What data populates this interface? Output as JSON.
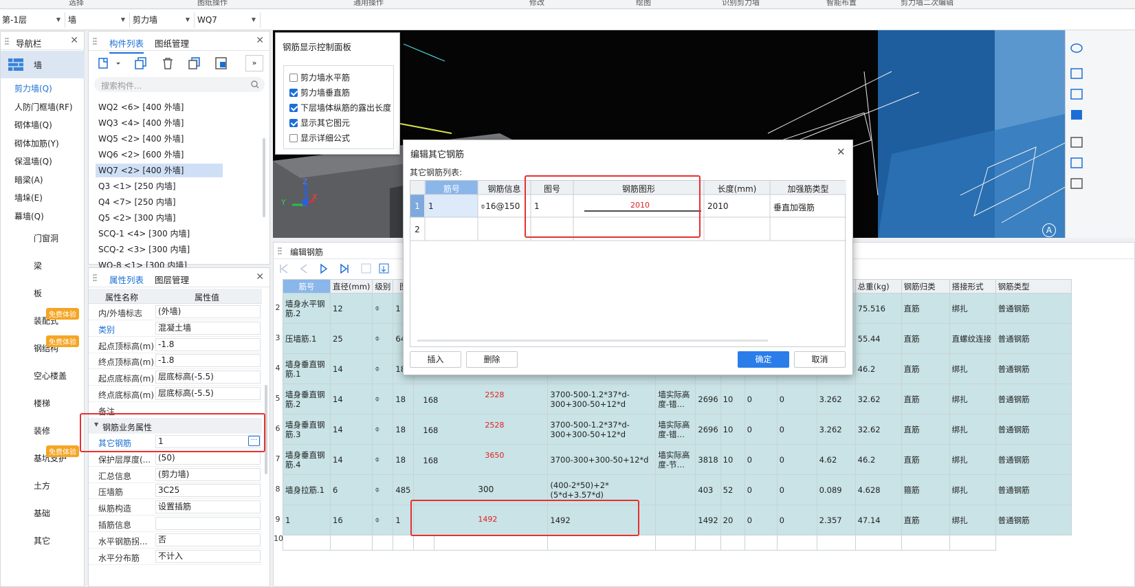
{
  "ribbon": [
    "选择",
    "图纸操作",
    "通用操作",
    "修改",
    "绘图",
    "识别剪力墙",
    "智能布置",
    "剪力墙二次编辑"
  ],
  "selectors": [
    "第-1层",
    "墙",
    "剪力墙",
    "WQ7"
  ],
  "nav": {
    "title": "导航栏",
    "top_category": "墙",
    "items": [
      "剪力墙(Q)",
      "人防门框墙(RF)",
      "砌体墙(Q)",
      "砌体加筋(Y)",
      "保温墙(Q)",
      "暗梁(A)",
      "墙垛(E)",
      "幕墙(Q)"
    ],
    "categories": [
      "门窗洞",
      "梁",
      "板",
      "装配式",
      "钢结构",
      "空心楼盖",
      "楼梯",
      "装修",
      "基坑支护",
      "土方",
      "基础",
      "其它"
    ],
    "badge": "免费体验"
  },
  "components": {
    "tabs": [
      "构件列表",
      "图纸管理"
    ],
    "search_placeholder": "搜索构件...",
    "items": [
      "WQ2 <6> [400 外墙]",
      "WQ3 <4> [400 外墙]",
      "WQ5 <2> [400 外墙]",
      "WQ6 <2> [600 外墙]",
      "WQ7 <2> [400 外墙]",
      "Q3 <1> [250 内墙]",
      "Q4 <7> [250 内墙]",
      "Q5 <2> [300 内墙]",
      "SCQ-1 <4> [300 内墙]",
      "SCQ-2 <3> [300 内墙]",
      "WQ-8 <1> [300 内墙]"
    ]
  },
  "props": {
    "tabs": [
      "属性列表",
      "图层管理"
    ],
    "header": [
      "属性名称",
      "属性值"
    ],
    "rows": [
      [
        "内/外墙标志",
        "(外墙)"
      ],
      [
        "类别",
        "混凝土墙"
      ],
      [
        "起点顶标高(m)",
        "-1.8"
      ],
      [
        "终点顶标高(m)",
        "-1.8"
      ],
      [
        "起点底标高(m)",
        "层底标高(-5.5)"
      ],
      [
        "终点底标高(m)",
        "层底标高(-5.5)"
      ],
      [
        "备注",
        ""
      ]
    ],
    "group": "钢筋业务属性",
    "rows2": [
      [
        "其它钢筋",
        "1"
      ],
      [
        "保护层厚度(...",
        "(50)"
      ],
      [
        "汇总信息",
        "(剪力墙)"
      ],
      [
        "压墙筋",
        "3C25"
      ],
      [
        "纵筋构造",
        "设置插筋"
      ],
      [
        "插筋信息",
        ""
      ],
      [
        "水平钢筋拐...",
        "否"
      ],
      [
        "水平分布筋",
        "不计入"
      ]
    ],
    "ellipsis": "···"
  },
  "view3d": {
    "axis_x": "X",
    "axis_y": "Y",
    "axis_z": "Z",
    "corner": "A"
  },
  "display_panel": {
    "title": "钢筋显示控制面板",
    "options": [
      {
        "label": "剪力墙水平筋",
        "checked": false
      },
      {
        "label": "剪力墙垂直筋",
        "checked": true
      },
      {
        "label": "下层墙体纵筋的露出长度",
        "checked": true
      },
      {
        "label": "显示其它图元",
        "checked": true
      },
      {
        "label": "显示详细公式",
        "checked": false
      }
    ]
  },
  "edit_rebar": {
    "title": "编辑钢筋",
    "headers": [
      "筋号",
      "直径(mm)",
      "级别",
      "图",
      "",
      "",
      "",
      "",
      "",
      "",
      "",
      "",
      "g)",
      "总重(kg)",
      "钢筋归类",
      "搭接形式",
      "钢筋类型"
    ],
    "rows": [
      {
        "n": "2",
        "name": "墙身水平钢筋.2",
        "dia": "12",
        "grade": "⌽",
        "fig": "1",
        "bars": "",
        "shape": "",
        "formula": "",
        "desc": "",
        "len": "",
        "cnt": "",
        "a": "",
        "b": "",
        "w1": "",
        "total": "75.516",
        "cat": "直筋",
        "lap": "绑扎",
        "type": "普通钢筋"
      },
      {
        "n": "3",
        "name": "压墙筋.1",
        "dia": "25",
        "grade": "⌽",
        "fig": "64",
        "bars": "",
        "shape": "",
        "formula": "",
        "desc": "",
        "len": "",
        "cnt": "",
        "a": "",
        "b": "",
        "w1": "",
        "total": "55.44",
        "cat": "直筋",
        "lap": "直螺纹连接",
        "type": "普通钢筋"
      },
      {
        "n": "4",
        "name": "墙身垂直钢筋.1",
        "dia": "14",
        "grade": "⌽",
        "fig": "18",
        "bars": "",
        "shape": "",
        "formula": "",
        "desc": "",
        "len": "",
        "cnt": "",
        "a": "",
        "b": "",
        "w1": "",
        "total": "46.2",
        "cat": "直筋",
        "lap": "绑扎",
        "type": "普通钢筋"
      },
      {
        "n": "5",
        "name": "墙身垂直钢筋.2",
        "dia": "14",
        "grade": "⌽",
        "fig": "18",
        "bars": "168",
        "shape": "2528",
        "formula": "3700-500-1.2*37*d-300+300-50+12*d",
        "desc": "墙实际高度-错…",
        "len": "2696",
        "cnt": "10",
        "a": "0",
        "b": "0",
        "w1": "3.262",
        "total": "32.62",
        "cat": "直筋",
        "lap": "绑扎",
        "type": "普通钢筋"
      },
      {
        "n": "6",
        "name": "墙身垂直钢筋.3",
        "dia": "14",
        "grade": "⌽",
        "fig": "18",
        "bars": "168",
        "shape": "2528",
        "formula": "3700-500-1.2*37*d-300+300-50+12*d",
        "desc": "墙实际高度-错…",
        "len": "2696",
        "cnt": "10",
        "a": "0",
        "b": "0",
        "w1": "3.262",
        "total": "32.62",
        "cat": "直筋",
        "lap": "绑扎",
        "type": "普通钢筋"
      },
      {
        "n": "7",
        "name": "墙身垂直钢筋.4",
        "dia": "14",
        "grade": "⌽",
        "fig": "18",
        "bars": "168",
        "shape": "3650",
        "formula": "3700-300+300-50+12*d",
        "desc": "墙实际高度-节…",
        "len": "3818",
        "cnt": "10",
        "a": "0",
        "b": "0",
        "w1": "4.62",
        "total": "46.2",
        "cat": "直筋",
        "lap": "绑扎",
        "type": "普通钢筋"
      },
      {
        "n": "8",
        "name": "墙身拉筋.1",
        "dia": "6",
        "grade": "⌽",
        "fig": "485",
        "bars": "",
        "shape": "300",
        "formula": "(400-2*50)+2*(5*d+3.57*d)",
        "desc": "",
        "len": "403",
        "cnt": "52",
        "a": "0",
        "b": "0",
        "w1": "0.089",
        "total": "4.628",
        "cat": "箍筋",
        "lap": "绑扎",
        "type": "普通钢筋"
      },
      {
        "n": "9",
        "name": "1",
        "dia": "16",
        "grade": "⌽",
        "fig": "1",
        "bars": "",
        "shape": "1492",
        "formula": "1492",
        "desc": "",
        "len": "1492",
        "cnt": "20",
        "a": "0",
        "b": "0",
        "w1": "2.357",
        "total": "47.14",
        "cat": "直筋",
        "lap": "绑扎",
        "type": "普通钢筋"
      }
    ],
    "last_row": "10"
  },
  "other_dialog": {
    "title": "编辑其它钢筋",
    "subtitle": "其它钢筋列表:",
    "headers": [
      "筋号",
      "钢筋信息",
      "图号",
      "钢筋图形",
      "长度(mm)",
      "加强筋类型"
    ],
    "row1": {
      "n": "1",
      "id": "1",
      "info": "⌽16@150",
      "fig": "1",
      "shape": "2010",
      "len": "2010",
      "type": "垂直加强筋"
    },
    "row2": {
      "n": "2"
    },
    "buttons": {
      "insert": "插入",
      "delete": "删除",
      "ok": "确定",
      "cancel": "取消"
    }
  },
  "colors": {
    "accent": "#1a6fd6",
    "highlight": "#e63030",
    "teal_row": "#c9e3e6"
  }
}
